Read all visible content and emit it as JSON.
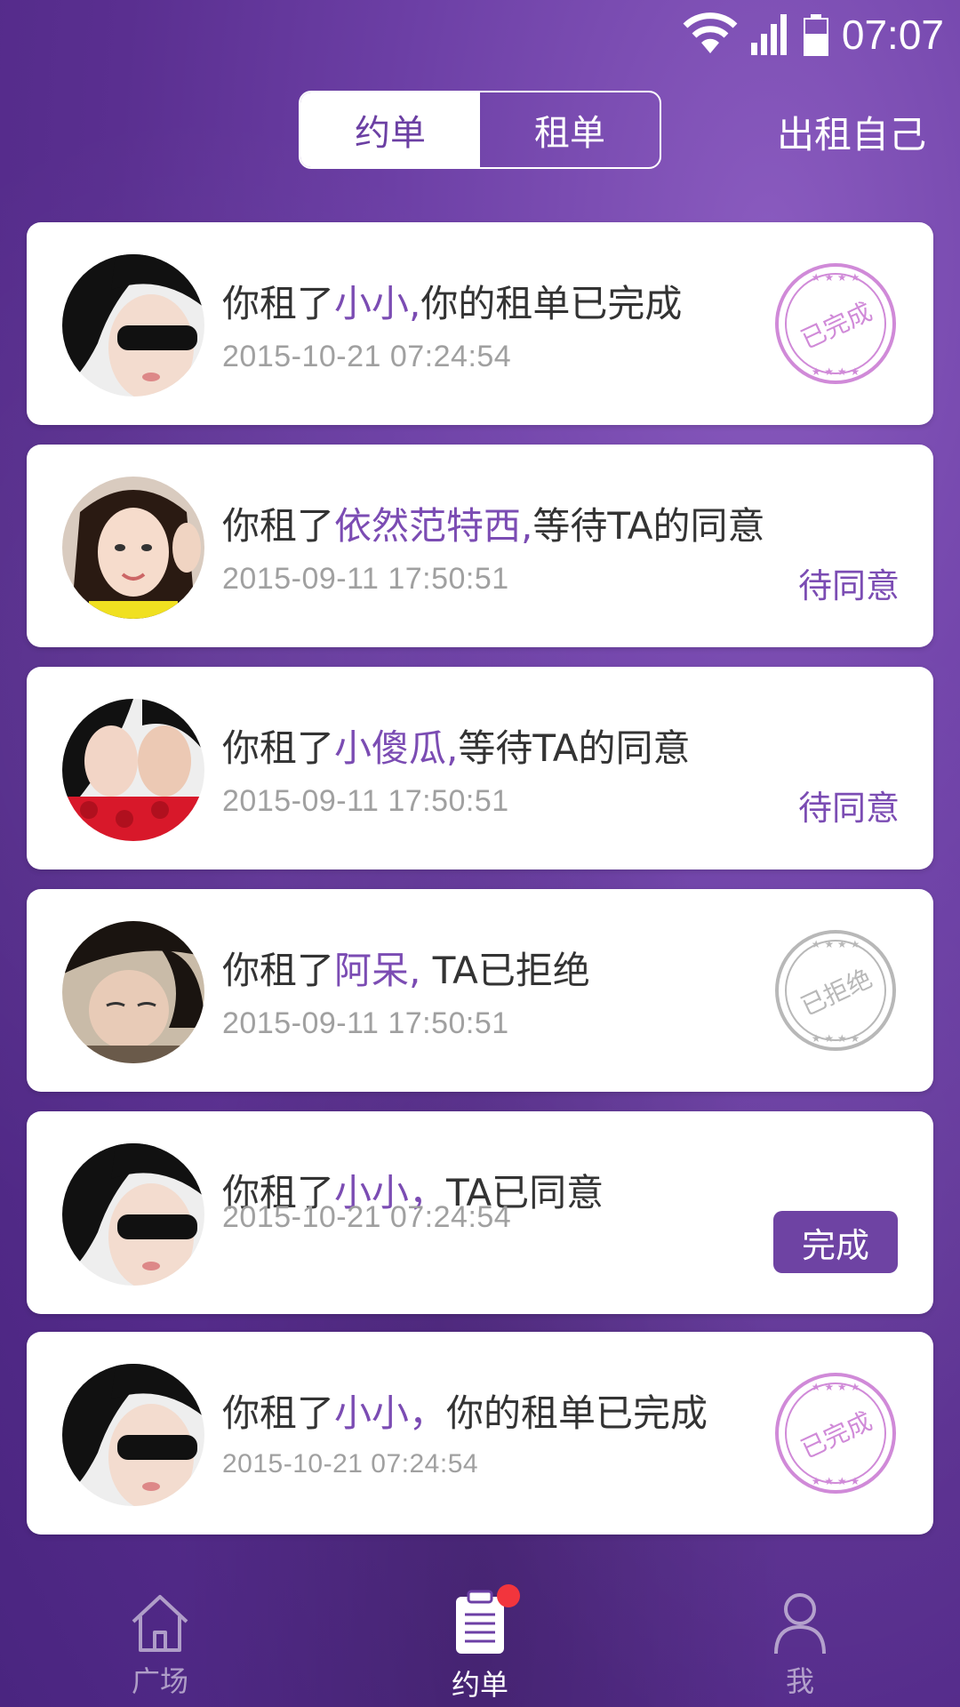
{
  "status_bar": {
    "time": "07:07"
  },
  "header": {
    "tabs": [
      {
        "label": "约单",
        "active": true
      },
      {
        "label": "租单",
        "active": false
      }
    ],
    "right_action": "出租自己"
  },
  "orders": [
    {
      "prefix": "你租了",
      "name": "小小,",
      "suffix": "你的租单已完成",
      "time": "2015-10-21 07:24:54",
      "status_type": "stamp",
      "stamp_text": "已完成"
    },
    {
      "prefix": "你租了",
      "name": "依然范特西,",
      "suffix": "等待TA的同意",
      "time": "2015-09-11 17:50:51",
      "status_type": "text",
      "status_text": "待同意"
    },
    {
      "prefix": "你租了",
      "name": "小傻瓜,",
      "suffix": "等待TA的同意",
      "time": "2015-09-11 17:50:51",
      "status_type": "text",
      "status_text": "待同意"
    },
    {
      "prefix": "你租了",
      "name": "阿呆,",
      "suffix": " TA已拒绝",
      "time": "2015-09-11 17:50:51",
      "status_type": "stamp",
      "stamp_text": "已拒绝"
    },
    {
      "prefix": "你租了",
      "name": "小小，",
      "suffix": "TA已同意",
      "time": "2015-10-21 07:24:54",
      "status_type": "button",
      "button_label": "完成"
    },
    {
      "prefix": "你租了",
      "name": "小小，",
      "suffix": "你的租单已完成",
      "time": "2015-10-21 07:24:54",
      "status_type": "stamp",
      "stamp_text": "已完成"
    }
  ],
  "tabbar": {
    "items": [
      {
        "label": "广场",
        "icon": "home-icon"
      },
      {
        "label": "约单",
        "icon": "clipboard-icon"
      },
      {
        "label": "我",
        "icon": "person-icon"
      }
    ]
  },
  "colors": {
    "accent": "#7b4cb3",
    "stamp_done": "#d08ad8",
    "stamp_rejected": "#b8b8b8",
    "badge": "#f2353d"
  }
}
